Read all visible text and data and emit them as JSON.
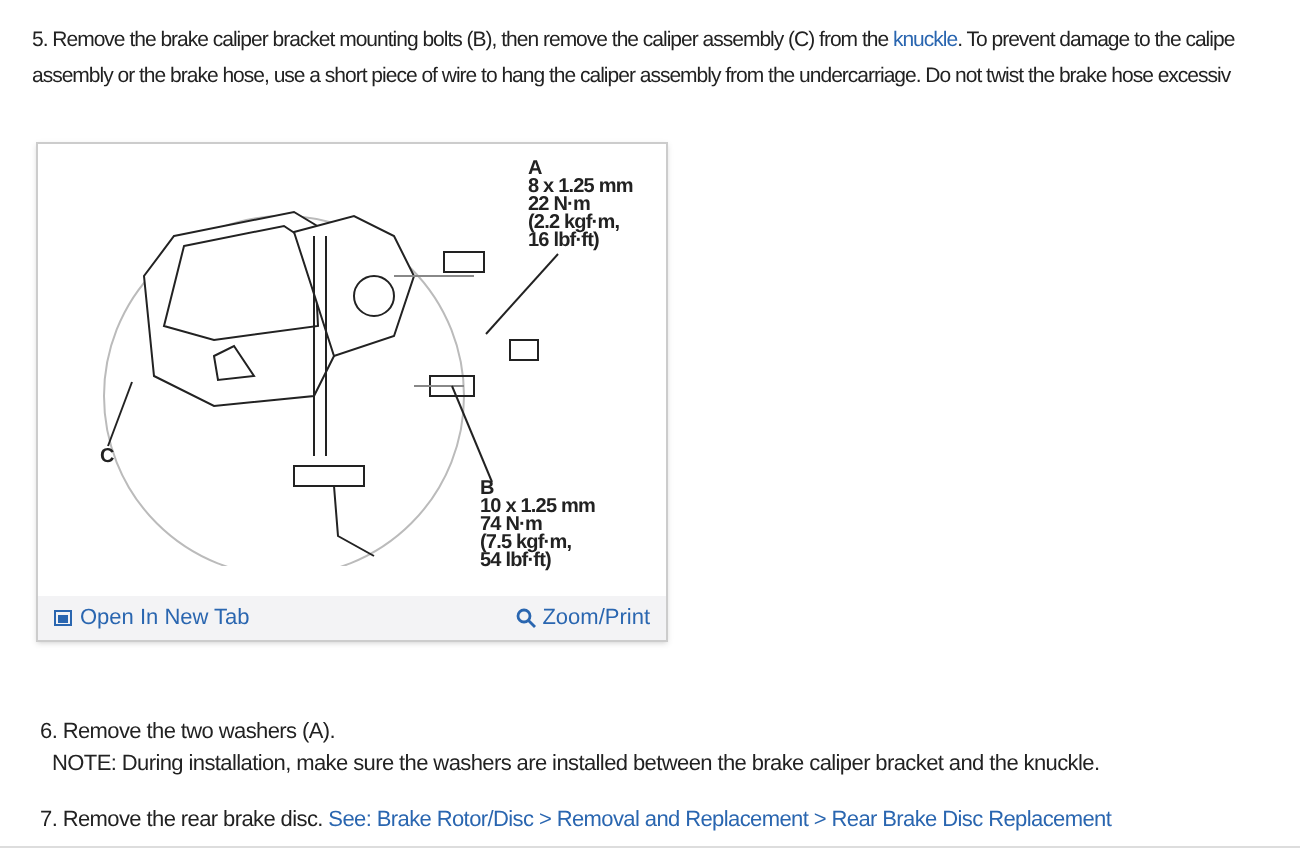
{
  "steps": [
    {
      "kind": "intro",
      "lines": [
        {
          "before": " 5. Remove the brake caliper bracket mounting bolts (B), then remove the caliper assembly (C) from the ",
          "link": "knuckle",
          "after": ". To prevent damage to the calipe"
        },
        {
          "before": "assembly or the brake hose, use a short piece of wire to hang the caliper assembly from the undercarriage. Do not twist the brake hose excessiv"
        }
      ]
    },
    {
      "kind": "figure",
      "callouts": [
        {
          "letter": "A",
          "lines": [
            "8 x 1.25 mm",
            "22 N·m",
            "(2.2 kgf·m,",
            "16 lbf·ft)"
          ]
        },
        {
          "letter": "B",
          "lines": [
            "10 x 1.25 mm",
            "74 N·m",
            "(7.5 kgf·m,",
            "54 lbf·ft)"
          ]
        },
        {
          "letter": "C"
        }
      ],
      "open_link": "Open In New Tab",
      "zoom_link": "Zoom/Print"
    },
    {
      "kind": "step",
      "text": "6. Remove the two washers (A).",
      "note": "NOTE: During installation, make sure the washers are installed between the brake caliper bracket and the knuckle."
    },
    {
      "kind": "step",
      "text": "7. Remove the rear brake disc.",
      "link": "See: Brake Rotor/Disc > Removal and Replacement > Rear Brake Disc Replacement"
    }
  ]
}
